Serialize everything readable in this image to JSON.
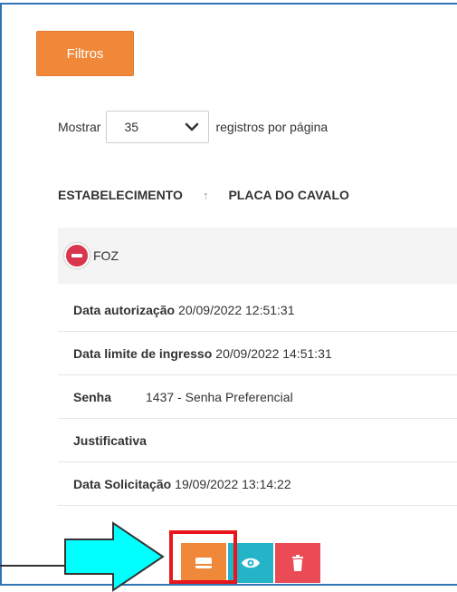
{
  "filters": {
    "label": "Filtros"
  },
  "page_length": {
    "prefix": "Mostrar",
    "value": "35",
    "suffix": "registros por página"
  },
  "table": {
    "columns": [
      "ESTABELECIMENTO",
      "PLACA DO CAVALO"
    ],
    "sort_indicator": "↑",
    "group": {
      "label": "FOZ"
    },
    "details": [
      {
        "label": "Data autorização",
        "value": "20/09/2022 12:51:31"
      },
      {
        "label": "Data limite de ingresso",
        "value": "20/09/2022 14:51:31"
      },
      {
        "label": "Senha",
        "value": "1437 - Senha Preferencial"
      },
      {
        "label": "Justificativa",
        "value": ""
      },
      {
        "label": "Data Solicitação",
        "value": "19/09/2022 13:14:22"
      }
    ]
  },
  "actions": [
    {
      "name": "edit-button",
      "icon": "card-icon",
      "color": "#f0883a"
    },
    {
      "name": "view-button",
      "icon": "eye-icon",
      "color": "#23b4c8"
    },
    {
      "name": "delete-button",
      "icon": "trash-icon",
      "color": "#ea4b55"
    }
  ],
  "colors": {
    "accent_orange": "#f0883a",
    "highlight_red": "#e8161b",
    "arrow_cyan": "#00ffff",
    "frame_blue": "#2e75b6"
  }
}
